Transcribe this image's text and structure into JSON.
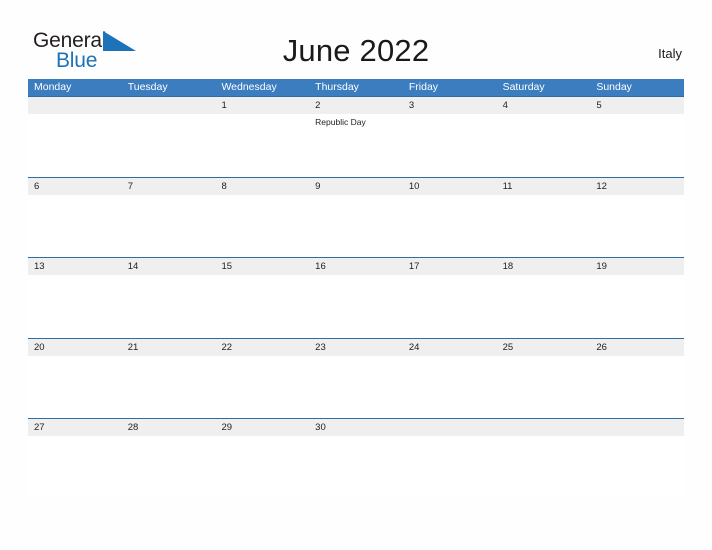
{
  "brand": {
    "name_part1": "General",
    "name_part2": "Blue",
    "flag_icon": "blue-triangle-flag-icon",
    "color_dark": "#231f20",
    "color_blue": "#1d72b8"
  },
  "header": {
    "title": "June 2022",
    "country": "Italy",
    "header_bg": "#3c7dc0",
    "band_bg": "#efefef",
    "band_line": "#2e6da4"
  },
  "weekdays": [
    "Monday",
    "Tuesday",
    "Wednesday",
    "Thursday",
    "Friday",
    "Saturday",
    "Sunday"
  ],
  "weeks": [
    {
      "days": [
        {
          "num": "",
          "event": ""
        },
        {
          "num": "",
          "event": ""
        },
        {
          "num": "1",
          "event": ""
        },
        {
          "num": "2",
          "event": "Republic Day"
        },
        {
          "num": "3",
          "event": ""
        },
        {
          "num": "4",
          "event": ""
        },
        {
          "num": "5",
          "event": ""
        }
      ]
    },
    {
      "days": [
        {
          "num": "6",
          "event": ""
        },
        {
          "num": "7",
          "event": ""
        },
        {
          "num": "8",
          "event": ""
        },
        {
          "num": "9",
          "event": ""
        },
        {
          "num": "10",
          "event": ""
        },
        {
          "num": "11",
          "event": ""
        },
        {
          "num": "12",
          "event": ""
        }
      ]
    },
    {
      "days": [
        {
          "num": "13",
          "event": ""
        },
        {
          "num": "14",
          "event": ""
        },
        {
          "num": "15",
          "event": ""
        },
        {
          "num": "16",
          "event": ""
        },
        {
          "num": "17",
          "event": ""
        },
        {
          "num": "18",
          "event": ""
        },
        {
          "num": "19",
          "event": ""
        }
      ]
    },
    {
      "days": [
        {
          "num": "20",
          "event": ""
        },
        {
          "num": "21",
          "event": ""
        },
        {
          "num": "22",
          "event": ""
        },
        {
          "num": "23",
          "event": ""
        },
        {
          "num": "24",
          "event": ""
        },
        {
          "num": "25",
          "event": ""
        },
        {
          "num": "26",
          "event": ""
        }
      ]
    },
    {
      "days": [
        {
          "num": "27",
          "event": ""
        },
        {
          "num": "28",
          "event": ""
        },
        {
          "num": "29",
          "event": ""
        },
        {
          "num": "30",
          "event": ""
        },
        {
          "num": "",
          "event": ""
        },
        {
          "num": "",
          "event": ""
        },
        {
          "num": "",
          "event": ""
        }
      ]
    }
  ]
}
